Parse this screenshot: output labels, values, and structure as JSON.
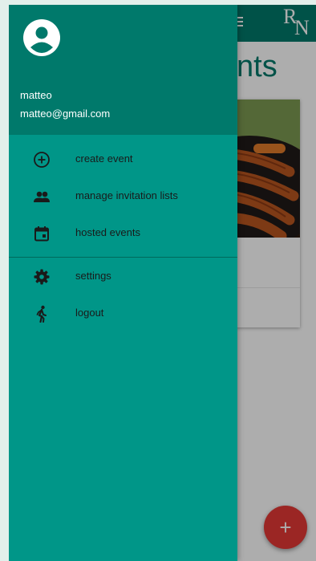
{
  "user": {
    "name": "matteo",
    "email": "matteo@gmail.com"
  },
  "nav": {
    "primary": [
      {
        "label": "create event",
        "icon": "add-circle-icon"
      },
      {
        "label": "manage invitation lists",
        "icon": "people-icon"
      },
      {
        "label": "hosted events",
        "icon": "calendar-icon"
      }
    ],
    "secondary": [
      {
        "label": "settings",
        "icon": "gear-icon"
      },
      {
        "label": "logout",
        "icon": "walking-person-icon"
      }
    ]
  },
  "background_page": {
    "title_fragment": "nts",
    "logo_letters": [
      "R",
      "N"
    ],
    "fab_label": "+"
  },
  "colors": {
    "header": "#00796b",
    "drawer": "#009688",
    "fab": "#e53935"
  }
}
